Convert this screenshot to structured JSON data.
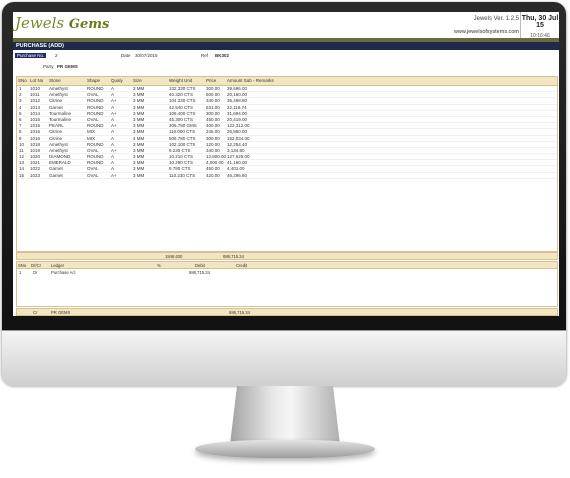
{
  "app": {
    "logo_a": "Jewels",
    "logo_b": "Gems",
    "version": "Jewels Ver. 1.2.5",
    "website": "www.jewelsofsystems.com",
    "date": "Thu, 30 Jul 15",
    "time": "10:16:46"
  },
  "module_title": "PURCHASE (ADD)",
  "header": {
    "purchase_no_label": "Purchase No.",
    "purchase_no": "2",
    "date_label": "Date",
    "date": "30/07/2015",
    "ref_label": "Ref",
    "ref": "BK302",
    "party_label": "Party",
    "party": "PR GEMS"
  },
  "grid": {
    "columns": [
      "SNo",
      "Lot No",
      "Stone",
      "Shape",
      "Qualy",
      "Size",
      "Weight Unit",
      "Price",
      "Amount Sub - Remarks"
    ],
    "rows": [
      [
        "1",
        "1010",
        "Amethyst",
        "ROUND",
        "A",
        "3 MM",
        "132.330 CTS",
        "300.00",
        "39,696.00"
      ],
      [
        "2",
        "1011",
        "Amethyst",
        "OVAL",
        "A",
        "3 MM",
        "40.320 CTS",
        "500.00",
        "20,160.00"
      ],
      [
        "3",
        "1012",
        "Citrine",
        "ROUND",
        "A+",
        "3 MM",
        "104.330 CTS",
        "340.00",
        "35,468.80"
      ],
      [
        "4",
        "1013",
        "Garnet",
        "ROUND",
        "A",
        "3 MM",
        "42.540 CTS",
        "531.00",
        "22,118.74"
      ],
      [
        "5",
        "1014",
        "Tourmaline",
        "ROUND",
        "A+",
        "3 MM",
        "106.400 CTS",
        "300.00",
        "31,694.00"
      ],
      [
        "6",
        "1015",
        "Tourmaline",
        "OVAL",
        "A",
        "3 MM",
        "45.300 CTS",
        "450.00",
        "20,419.00"
      ],
      [
        "7",
        "1015",
        "PEARL",
        "ROUND",
        "A+",
        "3 MM",
        "305.780 GMS",
        "400.00",
        "122,312.00"
      ],
      [
        "8",
        "1016",
        "Citrine",
        "MIX",
        "A",
        "3 MM",
        "110.000 CTS",
        "245.00",
        "26,950.00"
      ],
      [
        "9",
        "1016",
        "Citrine",
        "MIX",
        "A",
        "4 MM",
        "506.780 CTS",
        "300.00",
        "152,034.00"
      ],
      [
        "10",
        "1018",
        "Amethyst",
        "ROUND",
        "A",
        "3 MM",
        "102.100 CTS",
        "120.00",
        "12,254.40"
      ],
      [
        "11",
        "1019",
        "Amethyst",
        "OVAL",
        "A+",
        "3 MM",
        "9.230 CTS",
        "340.00",
        "3,134.80"
      ],
      [
        "12",
        "1020",
        "DIAMOND",
        "ROUND",
        "A",
        "3 MM",
        "10.210 CTS",
        "12,800.00",
        "127,625.00"
      ],
      [
        "13",
        "1021",
        "EMERALD",
        "ROUND",
        "A",
        "3 MM",
        "10.290 CTS",
        "4,000.00",
        "41,160.00"
      ],
      [
        "14",
        "1022",
        "Garnet",
        "OVAL",
        "A",
        "3 MM",
        "9.780 CTS",
        "450.00",
        "4,401.00"
      ],
      [
        "15",
        "1023",
        "Garnet",
        "OVAL",
        "A+",
        "3 MM",
        "110.230 CTS",
        "420.00",
        "46,296.60"
      ]
    ],
    "total_weight": "1848.630",
    "total_amount": "686,715.34"
  },
  "ledger": {
    "columns": [
      "SNo",
      "Dr/Cr",
      "Ledger",
      "%",
      "Debit",
      "Credit"
    ],
    "rows": [
      [
        "1",
        "Dr",
        "Purchase A/c",
        "",
        "686,715.34",
        ""
      ]
    ],
    "footer": {
      "drcr": "Cr",
      "ledger": "PR GEMS",
      "amount": "686,715.34"
    }
  }
}
